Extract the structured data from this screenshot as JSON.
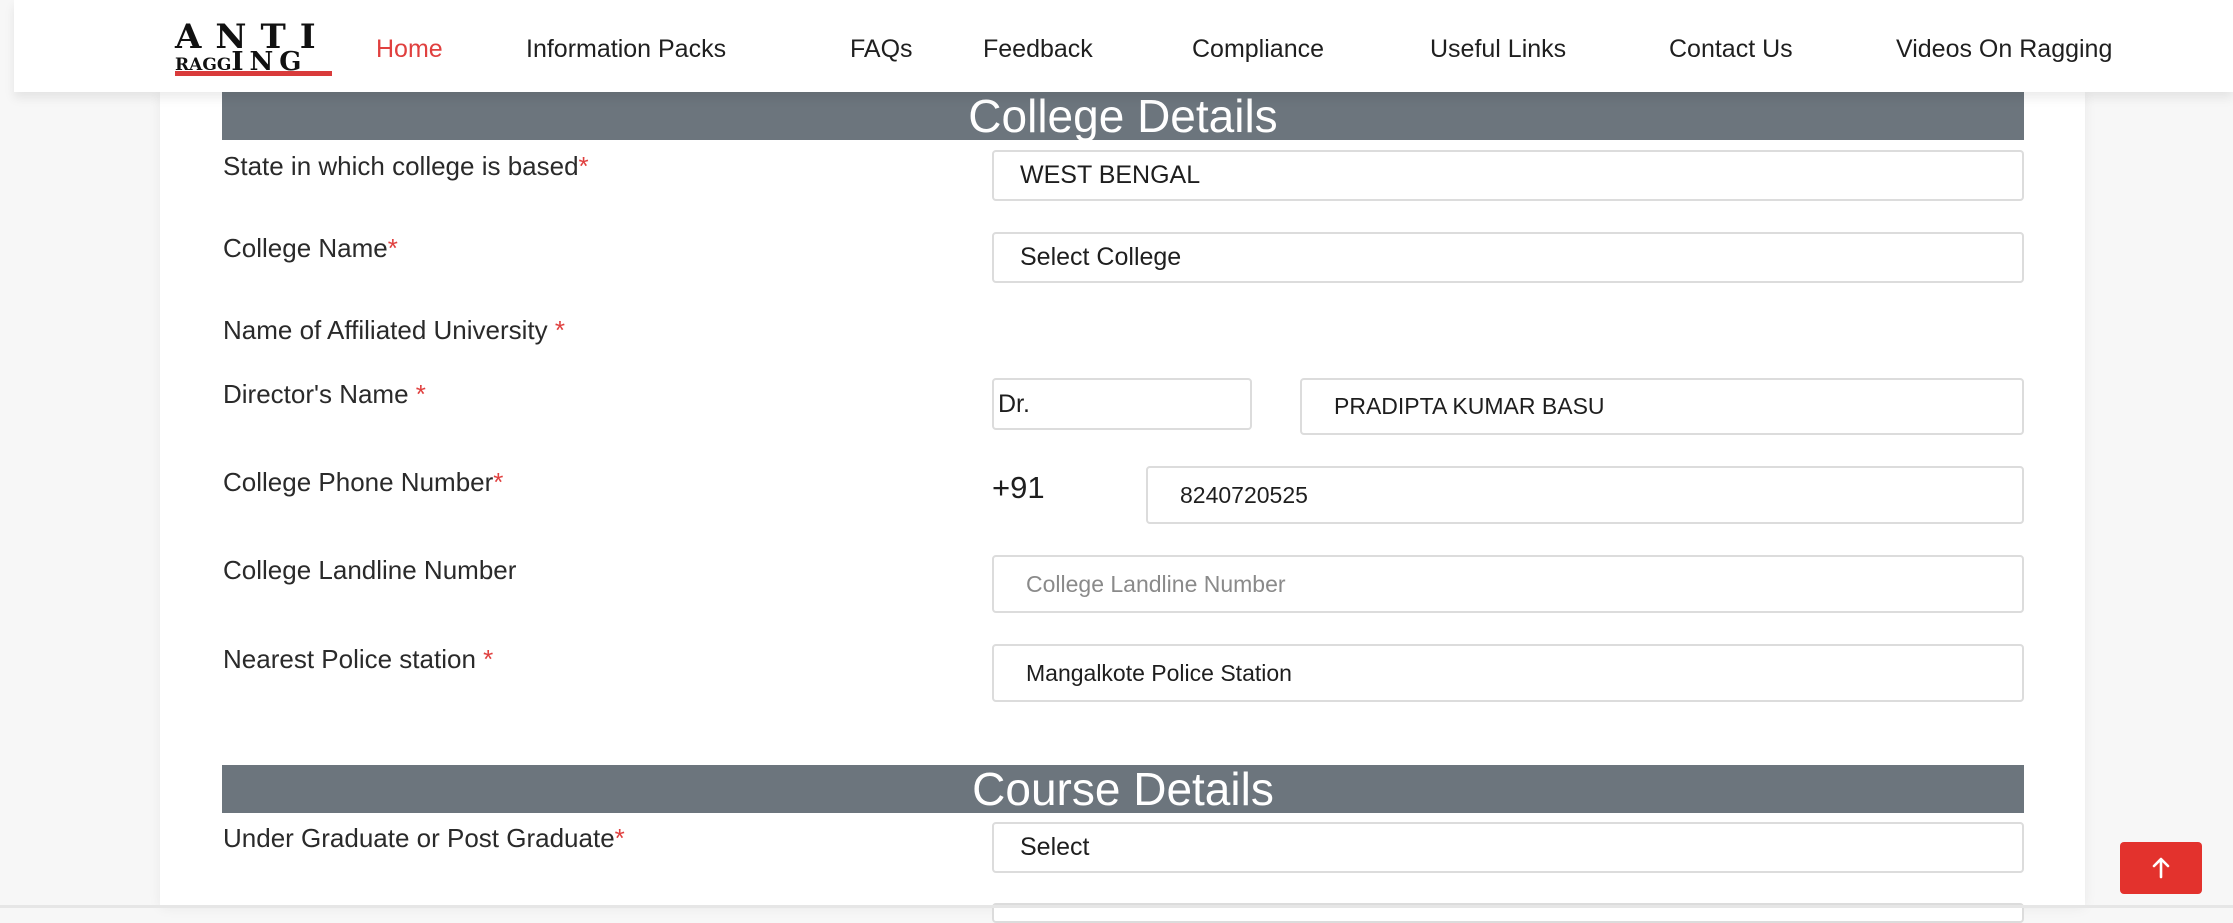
{
  "logo": {
    "top": "ANTI",
    "bottom_small": "RAGG",
    "bottom_large": "ING"
  },
  "nav": {
    "items": [
      {
        "label": "Home"
      },
      {
        "label": "Information Packs"
      },
      {
        "label": "FAQs"
      },
      {
        "label": "Feedback"
      },
      {
        "label": "Compliance"
      },
      {
        "label": "Useful Links"
      },
      {
        "label": "Contact Us"
      },
      {
        "label": "Videos On Ragging"
      }
    ]
  },
  "colors": {
    "accent": "#e0403f",
    "section_bar": "#6c757d",
    "scroll_button": "#e3322d"
  },
  "college": {
    "heading": "College Details",
    "state_label": "State in which college is based",
    "state_value": "WEST BENGAL",
    "college_name_label": "College Name",
    "college_name_value": "Select College",
    "university_label": "Name of Affiliated University ",
    "director_label": "Director's Name ",
    "director_title": "Dr.",
    "director_name": "PRADIPTA KUMAR BASU",
    "phone_label": "College Phone Number",
    "phone_prefix": "+91",
    "phone_value": "8240720525",
    "landline_label": "College Landline Number",
    "landline_placeholder": "College Landline Number",
    "police_label": "Nearest Police station ",
    "police_value": "Mangalkote Police Station",
    "required_mark": "*"
  },
  "course": {
    "heading": "Course Details",
    "ug_pg_label": "Under Graduate or Post Graduate",
    "ug_pg_value": "Select"
  },
  "icons": {
    "scroll_top": "arrow-up-icon"
  }
}
